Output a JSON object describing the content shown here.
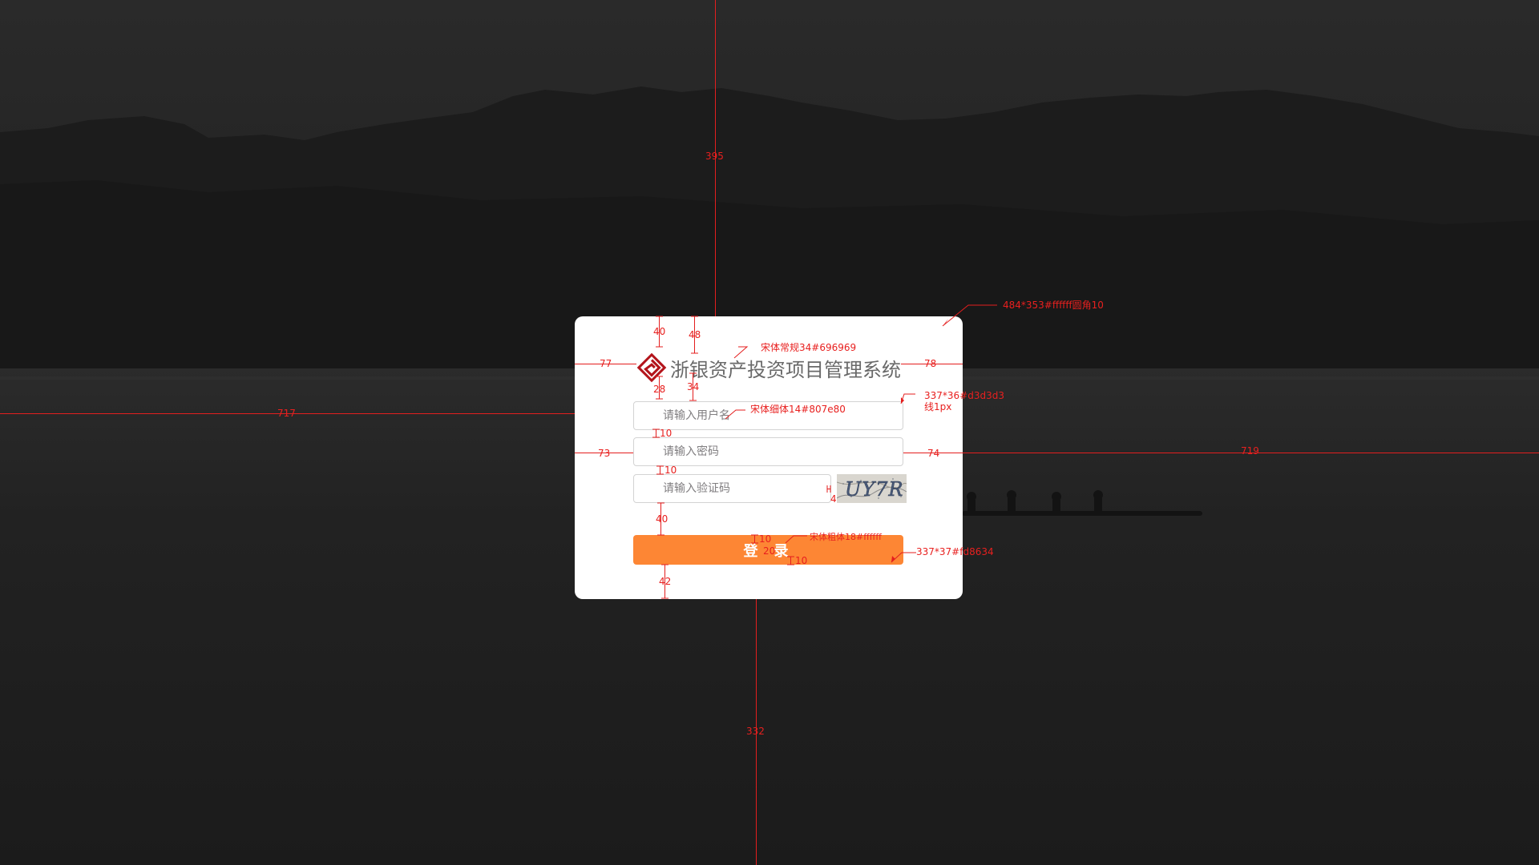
{
  "login": {
    "title": "浙银资产投资项目管理系统",
    "username_placeholder": "请输入用户名",
    "password_placeholder": "请输入密码",
    "captcha_placeholder": "请输入验证码",
    "captcha_text": "UY7R",
    "login_label": "登录"
  },
  "annotations": {
    "top_gap": "395",
    "bottom_gap": "332",
    "left_gap": "717",
    "right_gap": "719",
    "card_spec": "484*353#ffffff圆角10",
    "title_font": "宋体常规34#696969",
    "placeholder_font": "宋体细体14#807e80",
    "input_spec": "337*36#d3d3d3",
    "input_border": "线1px",
    "button_font": "宋体粗体18#ffffff",
    "button_spec": "337*37#fd8634",
    "logo_top": "40",
    "title_top": "48",
    "logo_left": "77",
    "title_right": "78",
    "logo_bottom": "28",
    "title_bottom": "34",
    "input_left": "73",
    "input_right": "74",
    "gap_user_pass": "10",
    "gap_pass_code": "10",
    "captcha_gap": "4",
    "gap_code_btn": "40",
    "btn_pad_top": "10",
    "btn_letter_gap": "20",
    "btn_pad_bottom": "10",
    "btn_bottom": "42"
  },
  "colors": {
    "title": "#696969",
    "placeholder": "#807e80",
    "border": "#d3d3d3",
    "button": "#fd8634",
    "annotation": "#e8201f"
  }
}
